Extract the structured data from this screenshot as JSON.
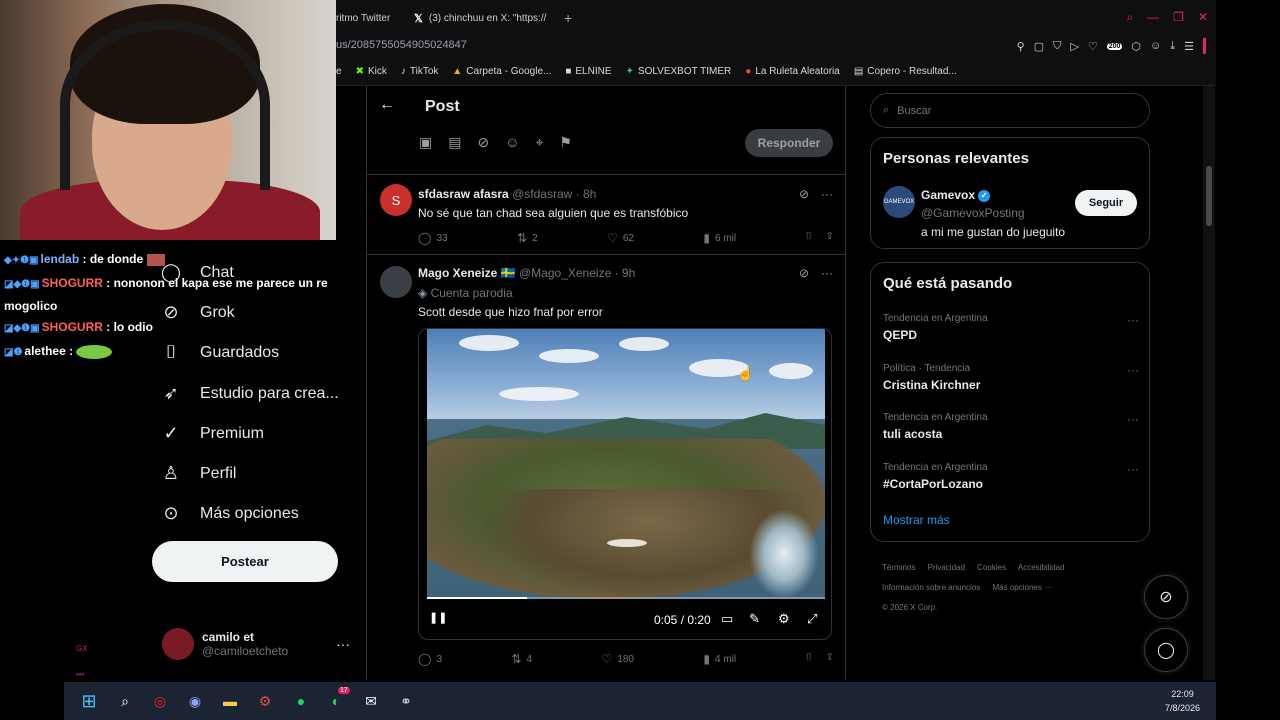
{
  "browser": {
    "tabs": [
      {
        "label": "ritmo Twitter"
      },
      {
        "label": "(3) chinchuu en X: \"https://"
      }
    ],
    "add_tab": "+",
    "url": "us/2085755054905024847",
    "zoom_badge": "200",
    "bookmarks": [
      {
        "label": "e",
        "icon": ""
      },
      {
        "label": "Kick",
        "icon": "✖"
      },
      {
        "label": "TikTok",
        "icon": "♪"
      },
      {
        "label": "Carpeta - Google...",
        "icon": "▲"
      },
      {
        "label": "ELNINE",
        "icon": "■"
      },
      {
        "label": "SOLVEXBOT TIMER",
        "icon": "✦"
      },
      {
        "label": "La Ruleta Aleatoria",
        "icon": "●"
      },
      {
        "label": "Copero - Resultad...",
        "icon": "▤"
      }
    ]
  },
  "chat": {
    "line1": {
      "user": "lendab",
      "text": ": de donde"
    },
    "line2": {
      "user": "SHOGURR",
      "text": ": nononon el kapa ese me parece un re",
      "cont": "mogolico"
    },
    "line3": {
      "user": "SHOGURR",
      "text": ": lo odio"
    },
    "line4": {
      "user": "alethee",
      "text": ":"
    }
  },
  "nav": {
    "chat": "Chat",
    "grok": "Grok",
    "saved": "Guardados",
    "studio": "Estudio para crea...",
    "premium": "Premium",
    "profile": "Perfil",
    "more": "Más opciones",
    "post_button": "Postear",
    "account_name": "camilo et",
    "account_handle": "@camiloetcheto"
  },
  "main": {
    "title": "Post",
    "reply_button": "Responder",
    "tweet1": {
      "name": "sfdasraw afasra",
      "handle": "@sfdasraw",
      "time": "· 8h",
      "avatar_letter": "S",
      "text": "No sé que tan chad sea alguien que es transfóbico",
      "replies": "33",
      "reposts": "2",
      "likes": "62",
      "views": "6 mil"
    },
    "tweet2": {
      "name": "Mago Xeneize",
      "flag": "🇸🇪",
      "handle": "@Mago_Xeneize",
      "time": "· 9h",
      "parody": "Cuenta parodia",
      "text": "Scott desde que hizo fnaf por error",
      "video_time": "0:05 / 0:20",
      "video_progress": 0.25,
      "replies": "3",
      "reposts": "4",
      "likes": "180",
      "views": "4 mil"
    }
  },
  "right": {
    "search_placeholder": "Buscar",
    "relevant_title": "Personas relevantes",
    "gamevox": {
      "name": "Gamevox",
      "handle": "@GamevoxPosting",
      "bio": "a mi me gustan do jueguito",
      "follow": "Seguir",
      "avatar_text": "GAMEVOX"
    },
    "trends_title": "Qué está pasando",
    "trends": [
      {
        "category": "Tendencia en Argentina",
        "name": "QEPD"
      },
      {
        "category": "Política · Tendencia",
        "name": "Cristina Kirchner"
      },
      {
        "category": "Tendencia en Argentina",
        "name": "tuli acosta"
      },
      {
        "category": "Tendencia en Argentina",
        "name": "#CortaPorLozano"
      }
    ],
    "show_more": "Mostrar más",
    "footer": {
      "terms": "Términos",
      "privacy": "Privacidad",
      "cookies": "Cookies",
      "accessibility": "Accesibilidad",
      "ads": "Información sobre anuncios",
      "more": "Más opciones ···",
      "copyright": "© 2026 X Corp."
    }
  },
  "taskbar": {
    "time": "22:09",
    "date": "7/8/2026",
    "whatsapp_badge": "17"
  }
}
